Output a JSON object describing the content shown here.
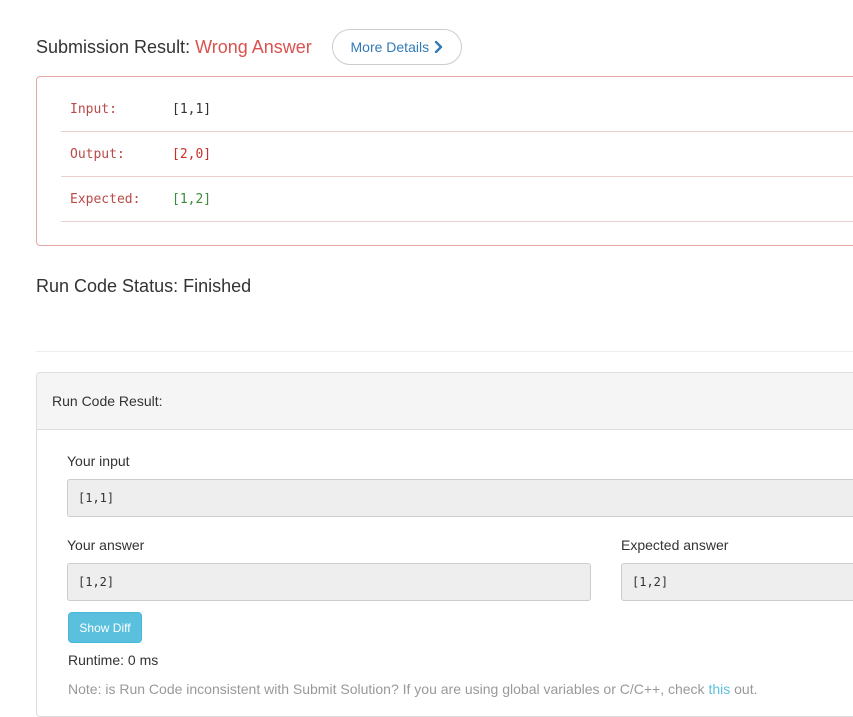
{
  "submission": {
    "label": "Submission Result:",
    "status": "Wrong Answer",
    "more_details_label": "More Details",
    "more_details_icon": "chevron-right-icon"
  },
  "result": {
    "rows": [
      {
        "key": "Input:",
        "value": "[1,1]"
      },
      {
        "key": "Output:",
        "value": "[2,0]"
      },
      {
        "key": "Expected:",
        "value": "[1,2]"
      }
    ]
  },
  "run_status": {
    "label": "Run Code Status: Finished"
  },
  "run_result": {
    "title": "Run Code Result:",
    "your_input_label": "Your input",
    "your_input_value": "[1,1]",
    "your_answer_label": "Your answer",
    "your_answer_value": "[1,2]",
    "expected_answer_label": "Expected answer",
    "expected_answer_value": "[1,2]",
    "show_diff_label": "Show Diff",
    "runtime": "Runtime: 0 ms",
    "note_prefix": "Note: is Run Code inconsistent with Submit Solution? If you are using global variables or C/C++, check ",
    "note_link": "this",
    "note_suffix": " out."
  },
  "colors": {
    "wrong_answer": "#d9534f",
    "expected_value": "#3c8c3c",
    "output_value": "#c9302c",
    "show_diff_button": "#5bc0de",
    "link": "#337ab7"
  }
}
